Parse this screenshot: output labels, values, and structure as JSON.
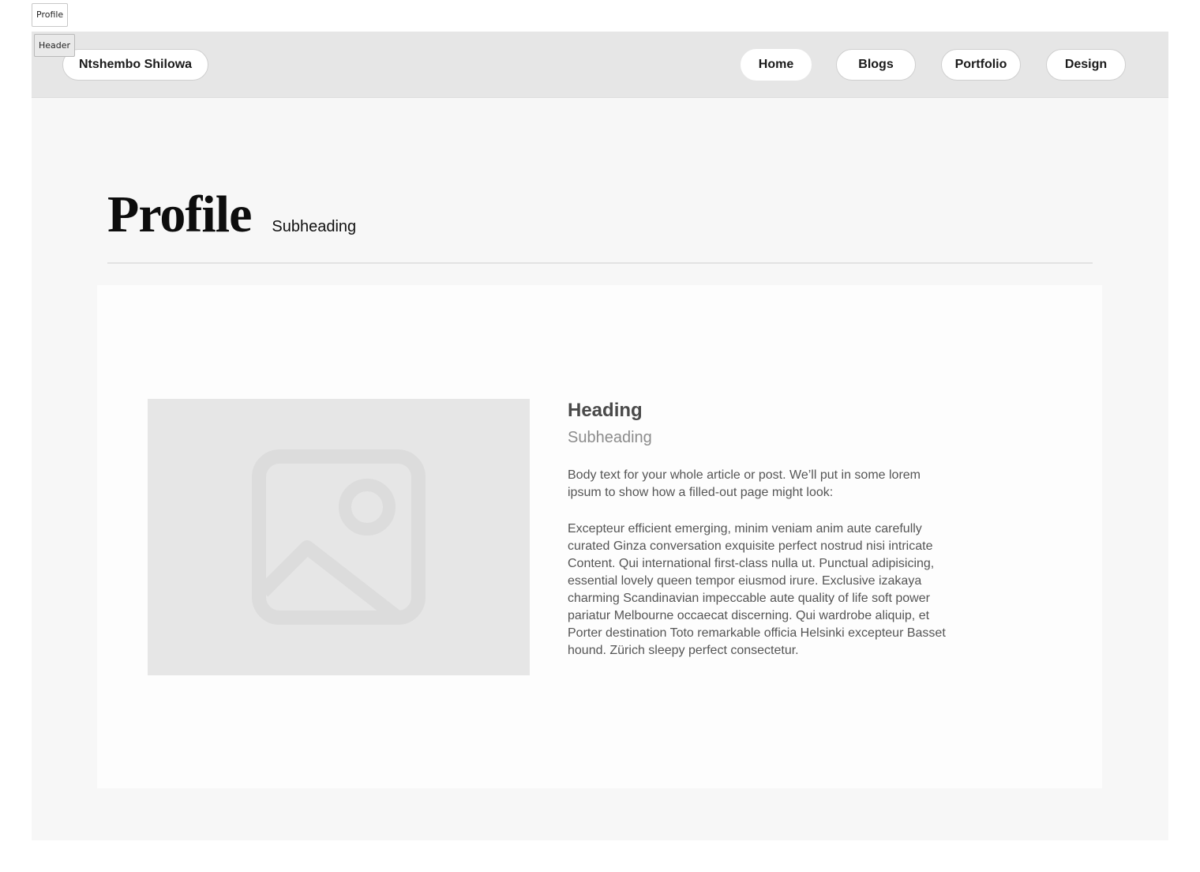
{
  "frame_labels": {
    "profile": "Profile",
    "header": "Header"
  },
  "header": {
    "brand": "Ntshembo Shilowa",
    "nav": {
      "home": "Home",
      "blogs": "Blogs",
      "portfolio": "Portfolio",
      "design": "Design"
    }
  },
  "hero": {
    "title": "Profile",
    "subtitle": "Subheading"
  },
  "card": {
    "image_icon": "image-placeholder-icon",
    "heading": "Heading",
    "subheading": "Subheading",
    "paragraph1": "Body text for your whole article or post. We’ll put in some lorem ipsum to show how a filled-out page might look:",
    "paragraph2": "Excepteur efficient emerging, minim veniam anim aute carefully curated Ginza conversation exquisite perfect nostrud nisi intricate Content. Qui  international first-class nulla ut. Punctual adipisicing, essential lovely queen tempor eiusmod irure. Exclusive izakaya charming Scandinavian impeccable aute quality of life soft power pariatur Melbourne occaecat discerning. Qui wardrobe aliquip, et Porter destination Toto remarkable officia Helsinki excepteur Basset hound. Zürich sleepy perfect consectetur."
  },
  "colors": {
    "page_bg": "#f7f7f7",
    "header_bg": "#e6e6e6",
    "card_bg": "#fdfdfd",
    "placeholder_bg": "#e6e6e6"
  }
}
